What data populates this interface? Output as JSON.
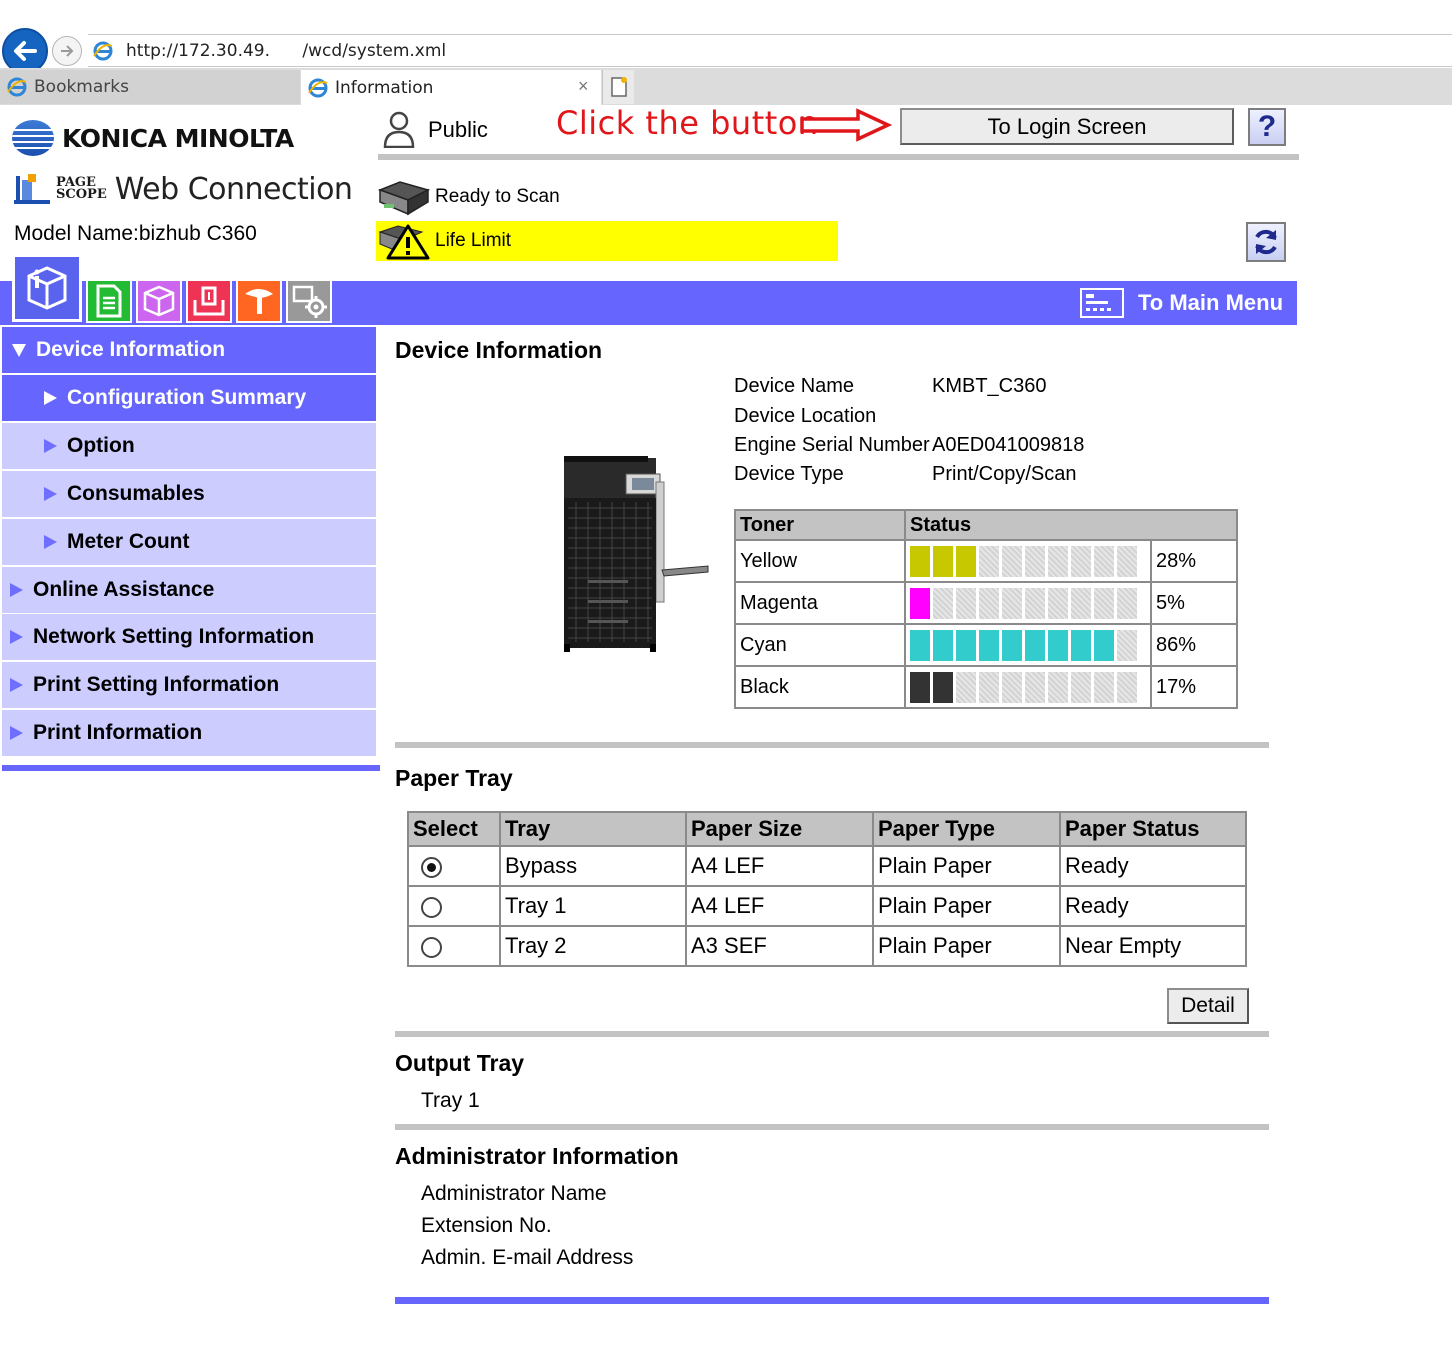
{
  "browser": {
    "address": "http://172.30.49.      /wcd/system.xml",
    "tabs": [
      {
        "label": "Bookmarks"
      },
      {
        "label": "Information"
      }
    ],
    "close_glyph": "×"
  },
  "header": {
    "brand": "KONICA MINOLTA",
    "product_small_1": "PAGE",
    "product_small_2": "SCOPE",
    "product": "Web Connection",
    "model": "Model Name:bizhub C360",
    "user_mode": "Public",
    "annotation": "Click the button",
    "login_button": "To Login Screen",
    "help_glyph": "?"
  },
  "status": {
    "scan": "Ready to Scan",
    "warning": "Life Limit"
  },
  "menubar": {
    "main_menu": "To Main Menu",
    "colors": {
      "bar": "#6666ff",
      "light": "#ccccff",
      "warning": "#ffff00"
    }
  },
  "sidebar": {
    "items": [
      {
        "label": "Device Information"
      },
      {
        "label": "Configuration Summary"
      },
      {
        "label": "Option"
      },
      {
        "label": "Consumables"
      },
      {
        "label": "Meter Count"
      },
      {
        "label": "Online Assistance"
      },
      {
        "label": "Network Setting Information"
      },
      {
        "label": "Print Setting Information"
      },
      {
        "label": "Print Information"
      }
    ]
  },
  "device_info": {
    "title": "Device Information",
    "fields": [
      {
        "label": "Device Name",
        "value": "KMBT_C360"
      },
      {
        "label": "Device Location",
        "value": ""
      },
      {
        "label": "Engine Serial Number",
        "value": "A0ED041009818"
      },
      {
        "label": "Device Type",
        "value": "Print/Copy/Scan"
      }
    ]
  },
  "toner": {
    "headers": [
      "Toner",
      "Status"
    ],
    "rows": [
      {
        "name": "Yellow",
        "percent": "28%",
        "level": 28,
        "color": "#c8c800"
      },
      {
        "name": "Magenta",
        "percent": "5%",
        "level": 5,
        "color": "#ff00ff"
      },
      {
        "name": "Cyan",
        "percent": "86%",
        "level": 86,
        "color": "#33cccc"
      },
      {
        "name": "Black",
        "percent": "17%",
        "level": 17,
        "color": "#333333"
      }
    ]
  },
  "paper_tray": {
    "title": "Paper Tray",
    "headers": [
      "Select",
      "Tray",
      "Paper Size",
      "Paper Type",
      "Paper Status"
    ],
    "rows": [
      {
        "selected": true,
        "tray": "Bypass",
        "size": "A4 LEF",
        "type": "Plain Paper",
        "status": "Ready"
      },
      {
        "selected": false,
        "tray": "Tray 1",
        "size": "A4 LEF",
        "type": "Plain Paper",
        "status": "Ready"
      },
      {
        "selected": false,
        "tray": "Tray 2",
        "size": "A3 SEF",
        "type": "Plain Paper",
        "status": "Near Empty"
      }
    ],
    "detail_button": "Detail"
  },
  "output_tray": {
    "title": "Output Tray",
    "value": "Tray 1"
  },
  "admin": {
    "title": "Administrator Information",
    "fields": [
      "Administrator Name",
      "Extension No.",
      "Admin. E-mail Address"
    ]
  }
}
